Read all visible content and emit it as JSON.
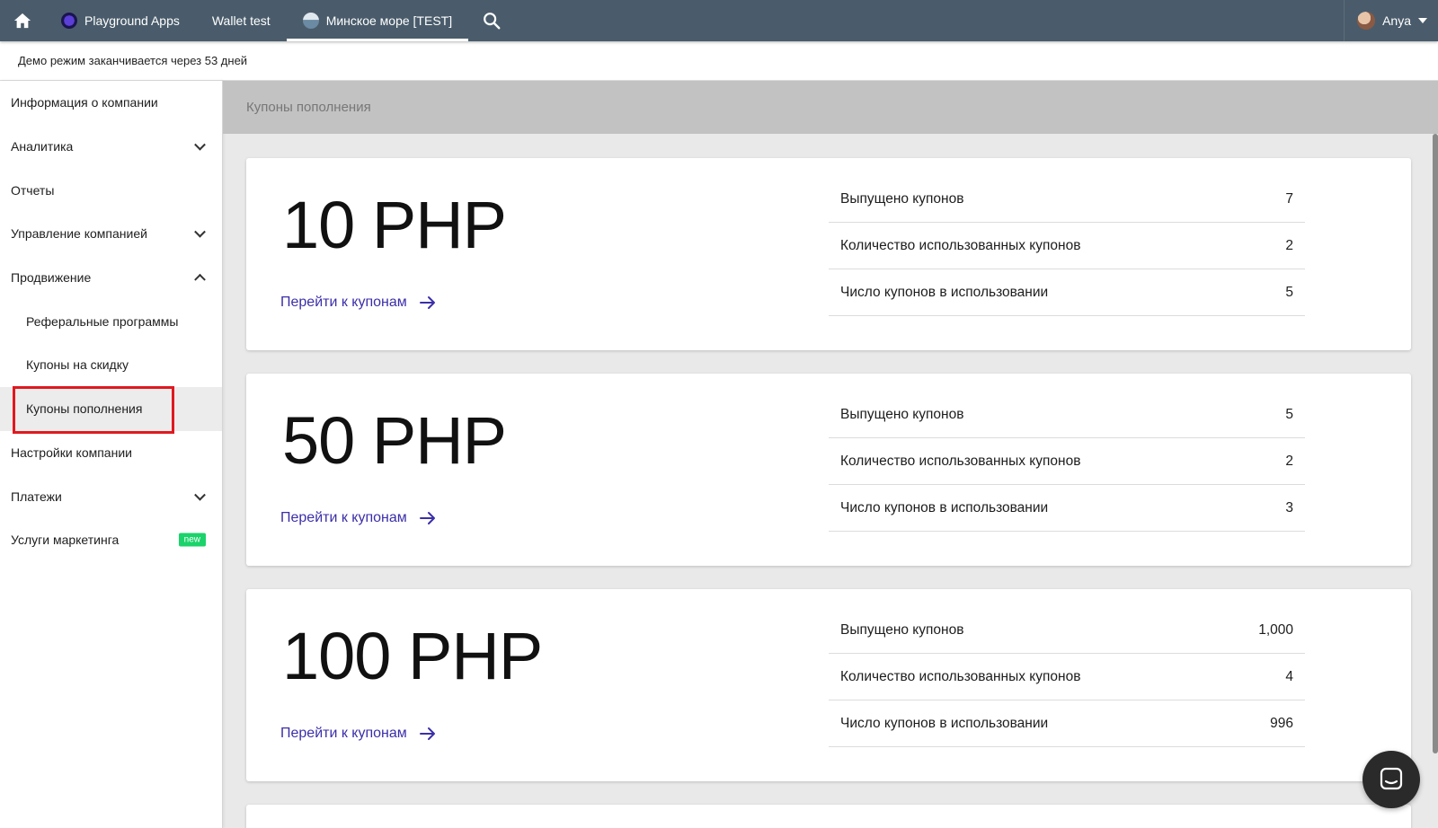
{
  "topbar": {
    "tabs": [
      {
        "label": "Playground Apps",
        "icon": "playground-app-icon",
        "active": false
      },
      {
        "label": "Wallet test",
        "active": false
      },
      {
        "label": "Минское море [TEST]",
        "icon": "minsk-sea-app-icon",
        "active": true
      }
    ],
    "user": {
      "name": "Anya"
    }
  },
  "demo_notice": "Демо режим заканчивается через 53 дней",
  "sidebar": {
    "items": [
      {
        "label": "Информация о компании"
      },
      {
        "label": "Аналитика",
        "expandable": true
      },
      {
        "label": "Отчеты"
      },
      {
        "label": "Управление компанией",
        "expandable": true
      },
      {
        "label": "Продвижение",
        "expanded": true
      },
      {
        "label": "Реферальные программы",
        "sub": true
      },
      {
        "label": "Купоны на скидку",
        "sub": true
      },
      {
        "label": "Купоны пополнения",
        "sub": true,
        "selected": true
      },
      {
        "label": "Настройки компании"
      },
      {
        "label": "Платежи",
        "expandable": true
      },
      {
        "label": "Услуги маркетинга",
        "badge": "new"
      }
    ]
  },
  "main": {
    "section_title": "Купоны пополнения",
    "cards": [
      {
        "amount": "10 PHP",
        "link": "Перейти к купонам",
        "stats": [
          {
            "label": "Выпущено купонов",
            "value": "7"
          },
          {
            "label": "Количество использованных купонов",
            "value": "2"
          },
          {
            "label": "Число купонов в использовании",
            "value": "5"
          }
        ]
      },
      {
        "amount": "50 PHP",
        "link": "Перейти к купонам",
        "stats": [
          {
            "label": "Выпущено купонов",
            "value": "5"
          },
          {
            "label": "Количество использованных купонов",
            "value": "2"
          },
          {
            "label": "Число купонов в использовании",
            "value": "3"
          }
        ]
      },
      {
        "amount": "100 PHP",
        "link": "Перейти к купонам",
        "stats": [
          {
            "label": "Выпущено купонов",
            "value": "1,000"
          },
          {
            "label": "Количество использованных купонов",
            "value": "4"
          },
          {
            "label": "Число купонов в использовании",
            "value": "996"
          }
        ]
      }
    ]
  },
  "colors": {
    "topbar": "#4a5c6b",
    "link": "#3b2fa9",
    "badge": "#1bd36a",
    "highlight": "#e0191f"
  }
}
